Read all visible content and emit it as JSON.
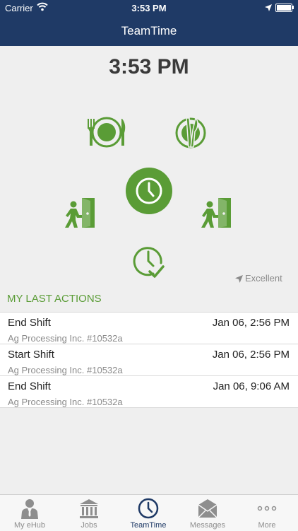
{
  "status_bar": {
    "carrier": "Carrier",
    "time": "3:53 PM"
  },
  "nav": {
    "title": "TeamTime"
  },
  "clock": {
    "time": "3:53 PM"
  },
  "actions": [
    {
      "icon": "meal-start-icon"
    },
    {
      "icon": "meal-end-icon"
    },
    {
      "icon": "clock-icon"
    },
    {
      "icon": "enter-door-icon"
    },
    {
      "icon": "exit-door-icon"
    },
    {
      "icon": "clock-check-icon"
    }
  ],
  "signal": {
    "quality": "Excellent"
  },
  "last_actions": {
    "title": "MY LAST ACTIONS",
    "items": [
      {
        "action": "End Shift",
        "date": "Jan 06, 2:56 PM",
        "company": "Ag Processing Inc. #10532a"
      },
      {
        "action": "Start Shift",
        "date": "Jan 06, 2:56 PM",
        "company": "Ag Processing Inc. #10532a"
      },
      {
        "action": "End Shift",
        "date": "Jan 06, 9:06 AM",
        "company": "Ag Processing Inc. #10532a"
      }
    ]
  },
  "tabs": [
    {
      "label": "My eHub",
      "icon": "person-icon",
      "active": false
    },
    {
      "label": "Jobs",
      "icon": "bank-icon",
      "active": false
    },
    {
      "label": "TeamTime",
      "icon": "clock-icon",
      "active": true
    },
    {
      "label": "Messages",
      "icon": "envelope-icon",
      "active": false
    },
    {
      "label": "More",
      "icon": "more-icon",
      "active": false
    }
  ],
  "colors": {
    "header": "#1f3a66",
    "accent": "#5a9c36",
    "background": "#efefef"
  }
}
